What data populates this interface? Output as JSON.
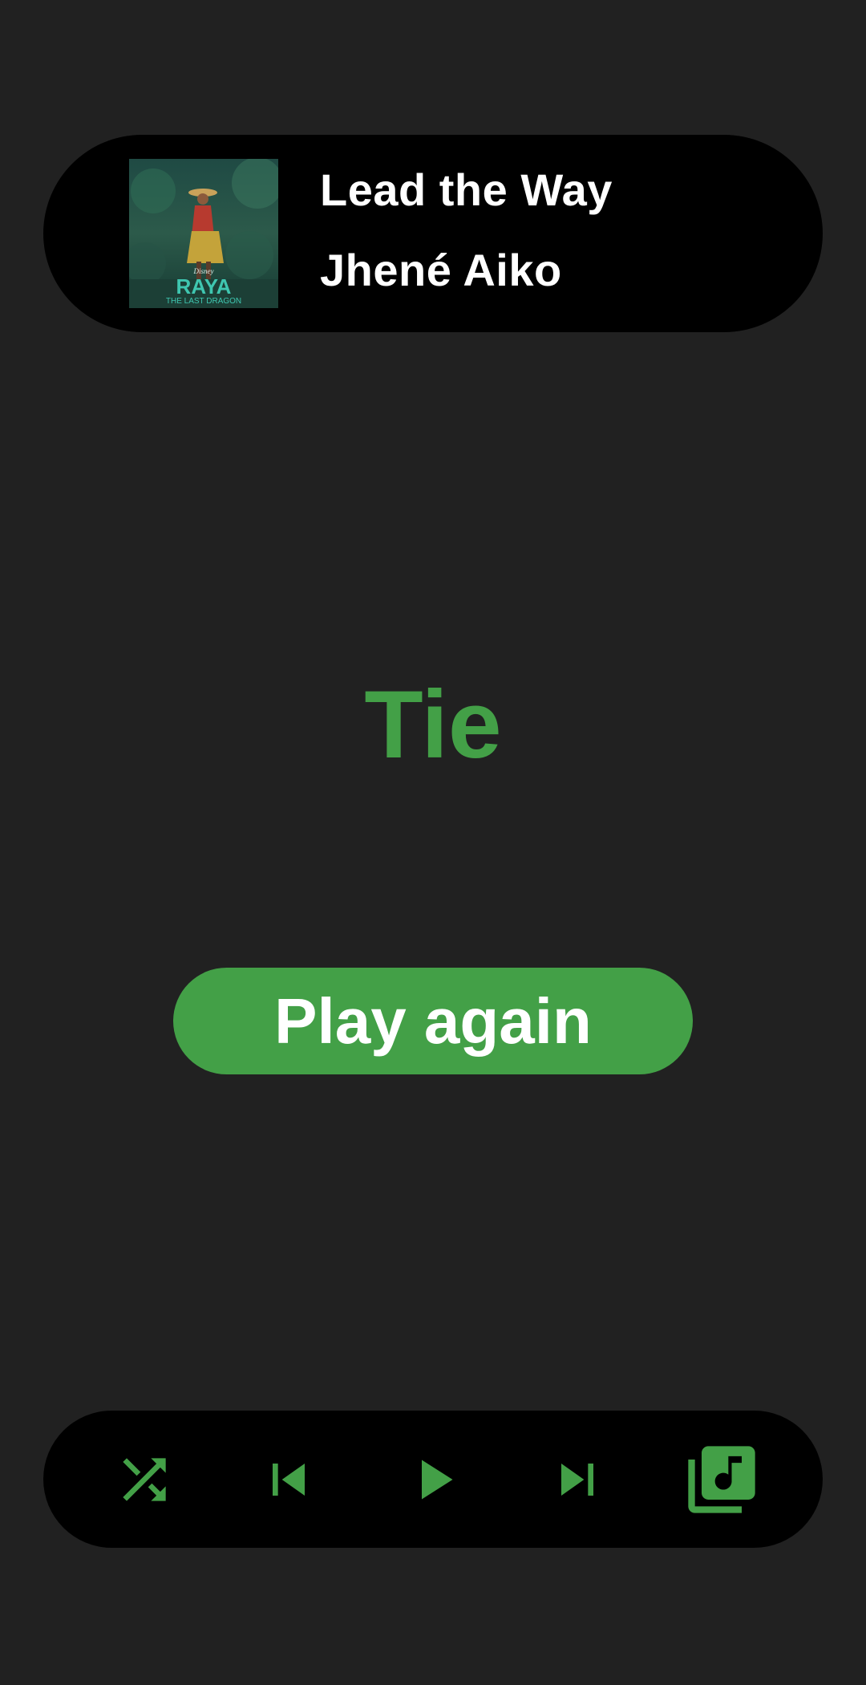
{
  "now_playing": {
    "title": "Lead the Way",
    "artist": "Jhené Aiko",
    "album_art": {
      "alt": "Raya and the Last Dragon album cover",
      "logo_text": "RAYA",
      "logo_subtext": "THE LAST DRAGON",
      "brand_text": "Disney"
    }
  },
  "game": {
    "result": "Tie",
    "play_again_label": "Play again"
  },
  "controls": {
    "items": [
      {
        "name": "shuffle",
        "icon": "shuffle-icon"
      },
      {
        "name": "previous",
        "icon": "skip-previous-icon"
      },
      {
        "name": "play",
        "icon": "play-icon"
      },
      {
        "name": "next",
        "icon": "skip-next-icon"
      },
      {
        "name": "library",
        "icon": "library-music-icon"
      }
    ]
  },
  "colors": {
    "background": "#212121",
    "panel": "#000000",
    "accent": "#43a047",
    "text": "#ffffff"
  }
}
